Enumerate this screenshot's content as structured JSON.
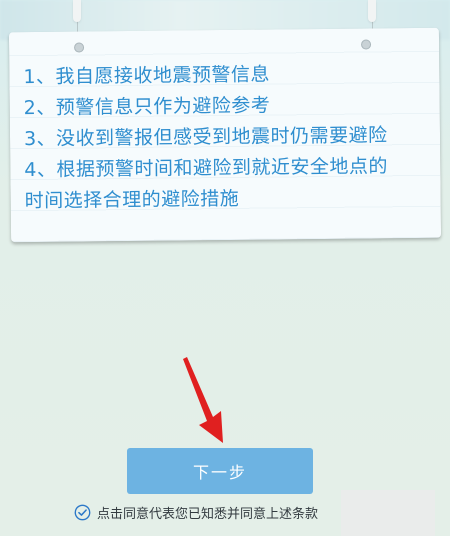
{
  "terms": {
    "items": [
      "1、我自愿接收地震预警信息",
      "2、预警信息只作为避险参考",
      "3、没收到警报但感受到地震时仍需要避险",
      "4、根据预警时间和避险到就近安全地点的",
      "时间选择合理的避险措施"
    ]
  },
  "actions": {
    "next_label": "下一步"
  },
  "consent": {
    "text": "点击同意代表您已知悉并同意上述条款",
    "checked": true
  },
  "colors": {
    "term_text": "#2f8ecf",
    "button": "#6db3e2",
    "check": "#2c78c8",
    "arrow": "#e02020"
  },
  "icons": {
    "arrow": "red-pointer-arrow-icon",
    "check": "check-circle-icon"
  }
}
